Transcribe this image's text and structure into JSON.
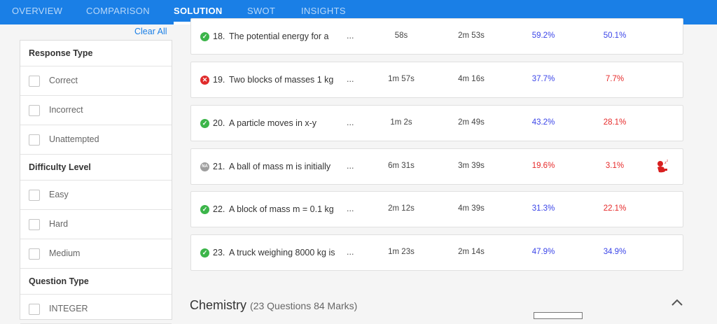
{
  "tabs": [
    "OVERVIEW",
    "COMPARISON",
    "SOLUTION",
    "SWOT",
    "INSIGHTS"
  ],
  "active_tab": "SOLUTION",
  "filters": {
    "clear_all": "Clear All",
    "response_type": {
      "title": "Response Type",
      "options": [
        "Correct",
        "Incorrect",
        "Unattempted"
      ]
    },
    "difficulty_level": {
      "title": "Difficulty Level",
      "options": [
        "Easy",
        "Hard",
        "Medium"
      ]
    },
    "question_type": {
      "title": "Question Type",
      "options": [
        "INTEGER"
      ]
    }
  },
  "questions": [
    {
      "num": "18.",
      "text": "The potential energy for a",
      "ellipsis": "...",
      "time_you": "58s",
      "time_avg": "2m 53s",
      "pct1": "59.2%",
      "pct2": "50.1%",
      "status": "correct",
      "pct1_color": "blue",
      "pct2_color": "blue"
    },
    {
      "num": "19.",
      "text": "Two blocks of masses 1 kg",
      "ellipsis": "...",
      "time_you": "1m 57s",
      "time_avg": "4m 16s",
      "pct1": "37.7%",
      "pct2": "7.7%",
      "status": "incorrect",
      "pct1_color": "blue",
      "pct2_color": "red"
    },
    {
      "num": "20.",
      "text": "A particle moves in x-y",
      "ellipsis": "...",
      "time_you": "1m 2s",
      "time_avg": "2m 49s",
      "pct1": "43.2%",
      "pct2": "28.1%",
      "status": "correct",
      "pct1_color": "blue",
      "pct2_color": "red"
    },
    {
      "num": "21.",
      "text": "A ball of mass m is initially",
      "ellipsis": "...",
      "time_you": "6m 31s",
      "time_avg": "3m 39s",
      "pct1": "19.6%",
      "pct2": "3.1%",
      "status": "unattempted",
      "status_text": "NA",
      "pct1_color": "red",
      "pct2_color": "red",
      "flag_icon": "sleeping-person-icon"
    },
    {
      "num": "22.",
      "text": "A block of mass m = 0.1 kg",
      "ellipsis": "...",
      "time_you": "2m 12s",
      "time_avg": "4m 39s",
      "pct1": "31.3%",
      "pct2": "22.1%",
      "status": "correct",
      "pct1_color": "blue",
      "pct2_color": "red"
    },
    {
      "num": "23.",
      "text": "A truck weighing 8000 kg is",
      "ellipsis": "...",
      "time_you": "1m 23s",
      "time_avg": "2m 14s",
      "pct1": "47.9%",
      "pct2": "34.9%",
      "status": "correct",
      "pct1_color": "blue",
      "pct2_color": "blue"
    }
  ],
  "section": {
    "title": "Chemistry",
    "subtitle": "(23 Questions 84 Marks)"
  },
  "colors": {
    "accent": "#1a7fe6",
    "correct": "#3cb54a",
    "incorrect": "#e02b2b",
    "blue_pct": "#3b45e8",
    "red_pct": "#e62a2a"
  }
}
